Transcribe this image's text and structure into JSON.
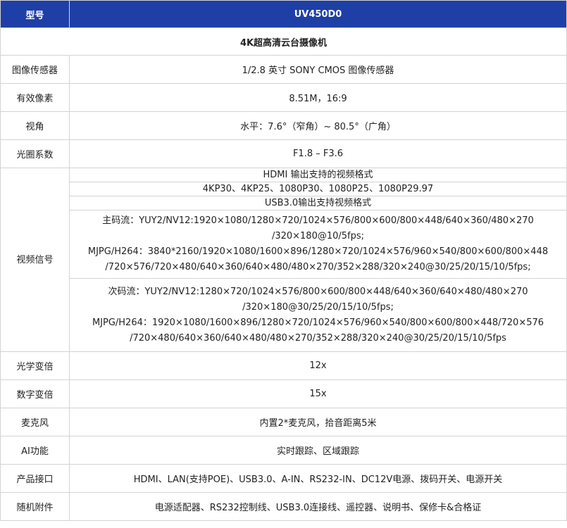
{
  "header": {
    "col1": "型号",
    "col2": "UV450D0"
  },
  "subtitle": "4K超高清云台摄像机",
  "specs": [
    {
      "label": "图像传感器",
      "value": "1/2.8 英寸 SONY CMOS 图像传感器"
    },
    {
      "label": "有效像素",
      "value": "8.51M，16:9"
    },
    {
      "label": "视角",
      "value": "水平：7.6°（窄角）~ 80.5°（广角）"
    },
    {
      "label": "光圈系数",
      "value": "F1.8 – F3.6"
    }
  ],
  "video": {
    "label": "视频信号",
    "hdmi_title": "HDMI 输出支持的视频格式",
    "hdmi_formats": "4KP30、4KP25、1080P30、1080P25、1080P29.97",
    "usb_title": "USB3.0输出支持视频格式",
    "main_stream": [
      "主码流：YUY2/NV12:1920×1080/1280×720/1024×576/800×600/800×448/640×360/480×270",
      "/320×180@10/5fps;",
      "MJPG/H264：3840*2160/1920×1080/1600×896/1280×720/1024×576/960×540/800×600/800×448",
      "/720×576/720×480/640×360/640×480/480×270/352×288/320×240@30/25/20/15/10/5fps;"
    ],
    "sub_stream": [
      "次码流：YUY2/NV12:1280×720/1024×576/800×600/800×448/640×360/640×480/480×270",
      "/320×180@30/25/20/15/10/5fps;",
      "MJPG/H264：1920×1080/1600×896/1280×720/1024×576/960×540/800×600/800×448/720×576",
      "/720×480/640×360/640×480/480×270/352×288/320×240@30/25/20/15/10/5fps"
    ]
  },
  "specs2": [
    {
      "label": "光学变倍",
      "value": "12x"
    },
    {
      "label": "数字变倍",
      "value": "15x"
    },
    {
      "label": "麦克风",
      "value": "内置2*麦克风，拾音距离5米"
    },
    {
      "label": "AI功能",
      "value": "实时跟踪、区域跟踪"
    },
    {
      "label": "产品接口",
      "value": "HDMI、LAN(支持POE)、USB3.0、A-IN、RS232-IN、DC12V电源、拨码开关、电源开关"
    },
    {
      "label": "随机附件",
      "value": "电源适配器、RS232控制线、USB3.0连接线、遥控器、说明书、保修卡&合格证"
    }
  ]
}
